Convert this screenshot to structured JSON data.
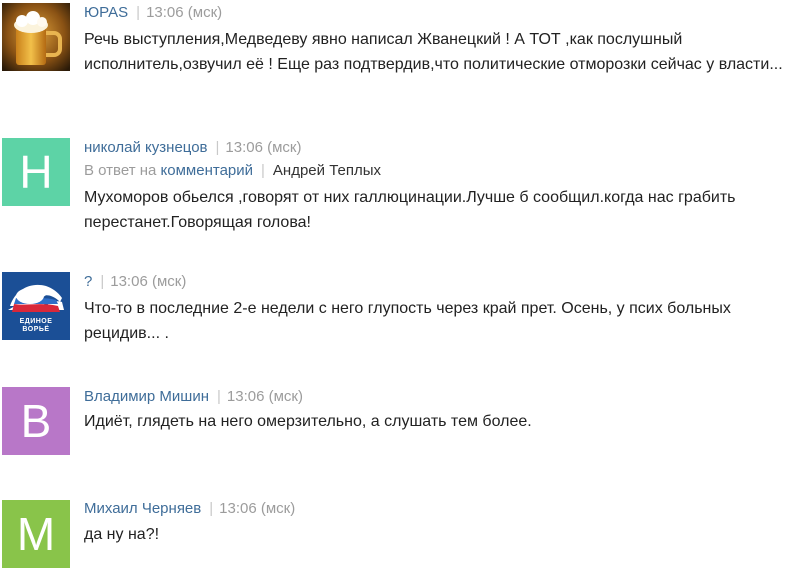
{
  "comments": [
    {
      "author": "ЮРАS",
      "time": "13:06 (мск)",
      "avatar": {
        "kind": "image",
        "icon": "beer-glass-icon"
      },
      "text": "Речь выступления,Медведеву явно написал Жванецкий ! А ТОТ ,как послушный исполнитель,озвучил её ! Еще раз подтвердив,что политические отморозки сейчас у власти..."
    },
    {
      "author": "николай кузнецов",
      "time": "13:06 (мск)",
      "avatar": {
        "kind": "letter",
        "letter": "H",
        "color": "#5dd3a6"
      },
      "reply": {
        "prefix": "В ответ на",
        "link": "комментарий",
        "target": "Андрей Теплых"
      },
      "text": "Мухоморов обьелся ,говорят от них галлюцинации.Лучше б сообщил.когда нас грабить перестанет.Говорящая голова!"
    },
    {
      "author": "?",
      "time": "13:06 (мск)",
      "avatar": {
        "kind": "logo",
        "icon": "united-russia-logo-icon",
        "logo_text_1": "ЕДИНОЕ",
        "logo_text_2": "ВОРЬЁ",
        "color": "#1b4f96"
      },
      "text": "Что-то в последние 2-е недели с него глупость через край прет. Осень, у псих больных рецидив... ."
    },
    {
      "author": "Владимир Мишин",
      "time": "13:06 (мск)",
      "avatar": {
        "kind": "letter",
        "letter": "B",
        "color": "#b877c8"
      },
      "text": "Идиёт, глядеть на него омерзительно, а слушать тем более."
    },
    {
      "author": "Михаил Черняев",
      "time": "13:06 (мск)",
      "avatar": {
        "kind": "letter",
        "letter": "M",
        "color": "#89c44a"
      },
      "text": "да ну на?!"
    }
  ]
}
